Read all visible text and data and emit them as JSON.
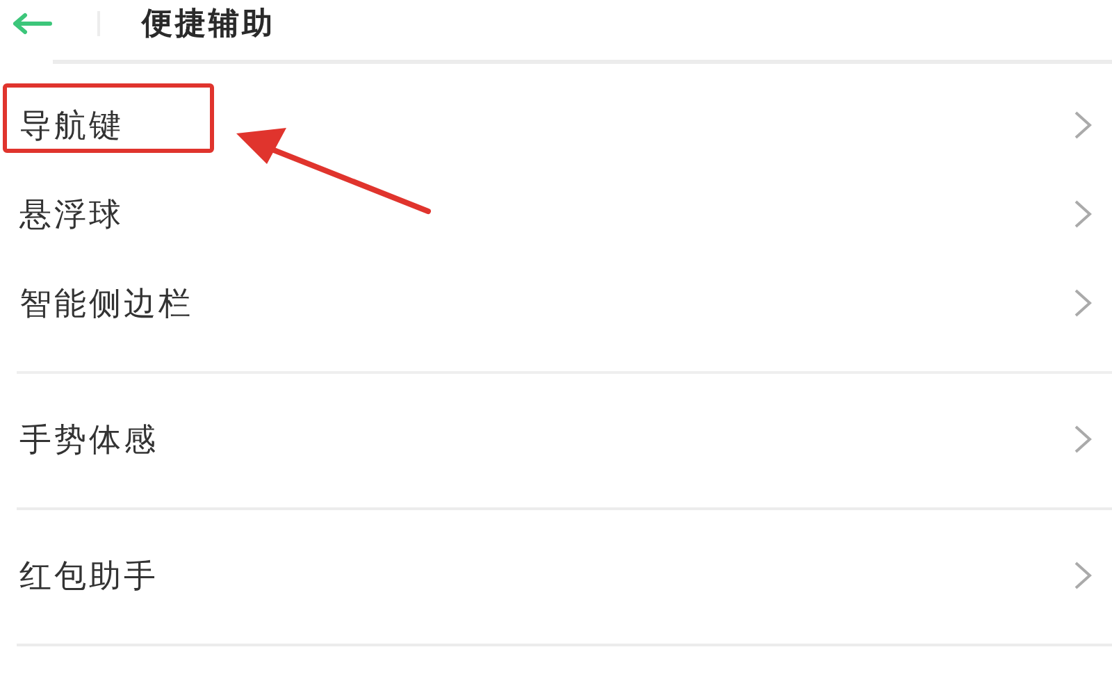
{
  "header": {
    "title": "便捷辅助"
  },
  "groups": [
    {
      "items": [
        {
          "label": "导航键",
          "highlighted": true
        },
        {
          "label": "悬浮球",
          "highlighted": false
        },
        {
          "label": "智能侧边栏",
          "highlighted": false
        }
      ]
    },
    {
      "items": [
        {
          "label": "手势体感",
          "highlighted": false
        }
      ]
    },
    {
      "items": [
        {
          "label": "红包助手",
          "highlighted": false
        }
      ]
    }
  ]
}
